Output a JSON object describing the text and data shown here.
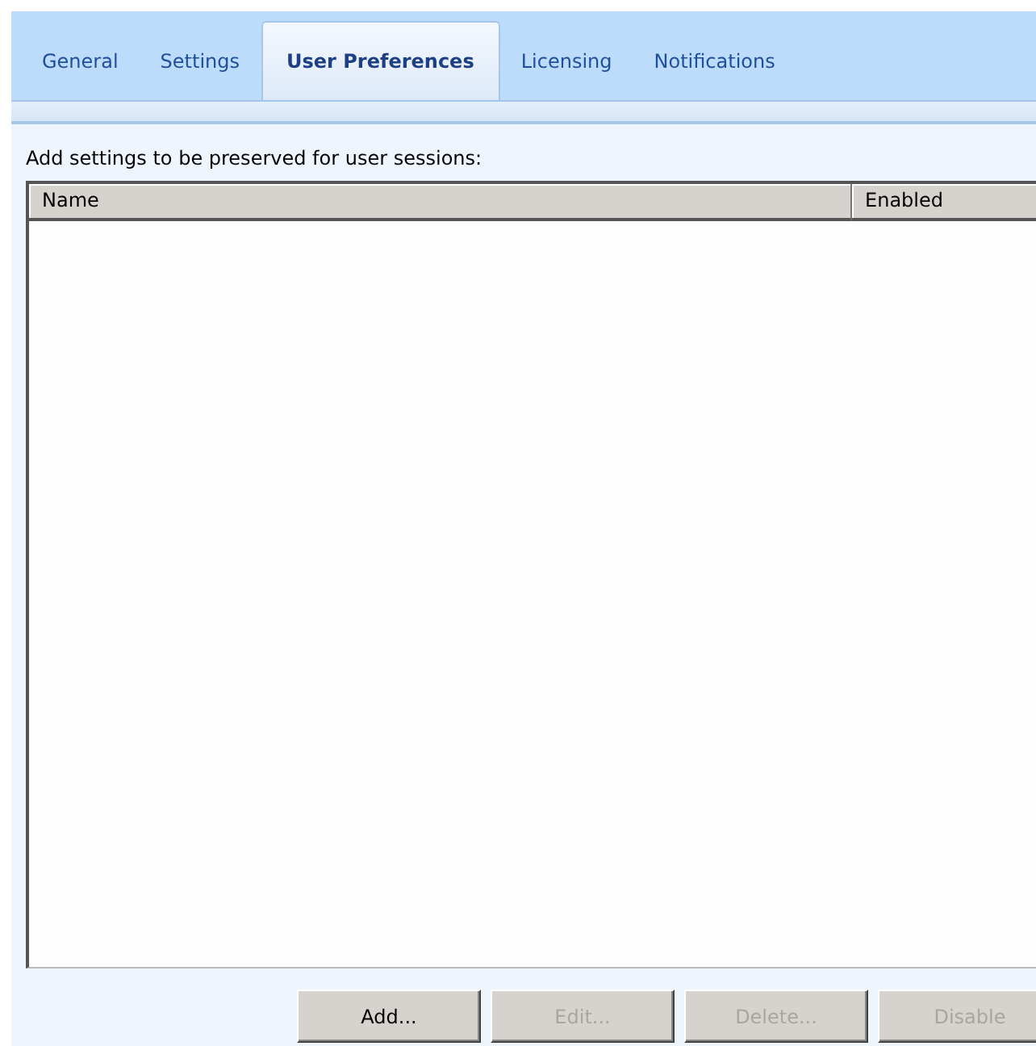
{
  "tabs": [
    {
      "label": "General",
      "selected": false
    },
    {
      "label": "Settings",
      "selected": false
    },
    {
      "label": "User Preferences",
      "selected": true
    },
    {
      "label": "Licensing",
      "selected": false
    },
    {
      "label": "Notifications",
      "selected": false
    }
  ],
  "instruction": "Add settings to be preserved for user sessions:",
  "table": {
    "columns": [
      "Name",
      "Enabled"
    ]
  },
  "buttons": [
    {
      "label": "Add...",
      "disabled": false
    },
    {
      "label": "Edit...",
      "disabled": true
    },
    {
      "label": "Delete...",
      "disabled": true
    },
    {
      "label": "Disable",
      "disabled": true
    }
  ]
}
